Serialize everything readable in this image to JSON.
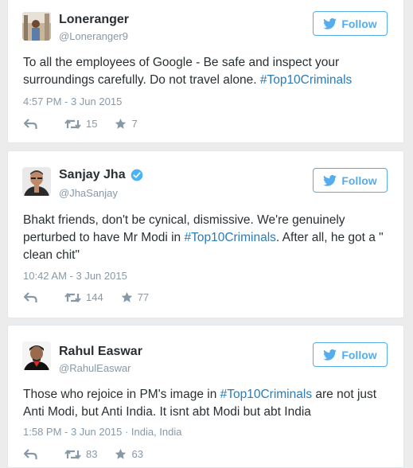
{
  "tweets": [
    {
      "name": "Loneranger",
      "handle": "@Loneranger9",
      "verified": false,
      "follow_label": "Follow",
      "text_parts": [
        {
          "t": "To all the employees of Google - Be safe and inspect your surroundings carefully. Do not travel alone. "
        },
        {
          "t": "#Top10Criminals",
          "tag": true
        }
      ],
      "timestamp": "4:57 PM - 3 Jun 2015",
      "location": "",
      "retweets": "15",
      "favorites": "7"
    },
    {
      "name": "Sanjay Jha",
      "handle": "@JhaSanjay",
      "verified": true,
      "follow_label": "Follow",
      "text_parts": [
        {
          "t": "Bhakt friends, don't be cynical, dismissive. We're genuinely perturbed to have Mr Modi in "
        },
        {
          "t": "#Top10Criminals",
          "tag": true
        },
        {
          "t": ". After all, he got a \" clean chit\""
        }
      ],
      "timestamp": "10:42 AM - 3 Jun 2015",
      "location": "",
      "retweets": "144",
      "favorites": "77"
    },
    {
      "name": "Rahul Easwar",
      "handle": "@RahulEaswar",
      "verified": false,
      "follow_label": "Follow",
      "text_parts": [
        {
          "t": "Those who rejoice in PM's image in  "
        },
        {
          "t": "#Top10Criminals",
          "tag": true
        },
        {
          "t": " are not just Anti Modi, but Anti India. It isnt abt Modi but abt India"
        }
      ],
      "timestamp": "1:58 PM - 3 Jun 2015",
      "location": "India, India",
      "retweets": "83",
      "favorites": "63"
    }
  ],
  "icons": {
    "bird": "twitter-bird-icon",
    "reply": "reply-icon",
    "retweet": "retweet-icon",
    "favorite": "star-icon",
    "verified": "verified-badge-icon"
  },
  "colors": {
    "accent": "#55acee",
    "hashtag": "#2b7bb9",
    "muted": "#8899a6",
    "text": "#292f33",
    "verified": "#4ab3f4"
  }
}
